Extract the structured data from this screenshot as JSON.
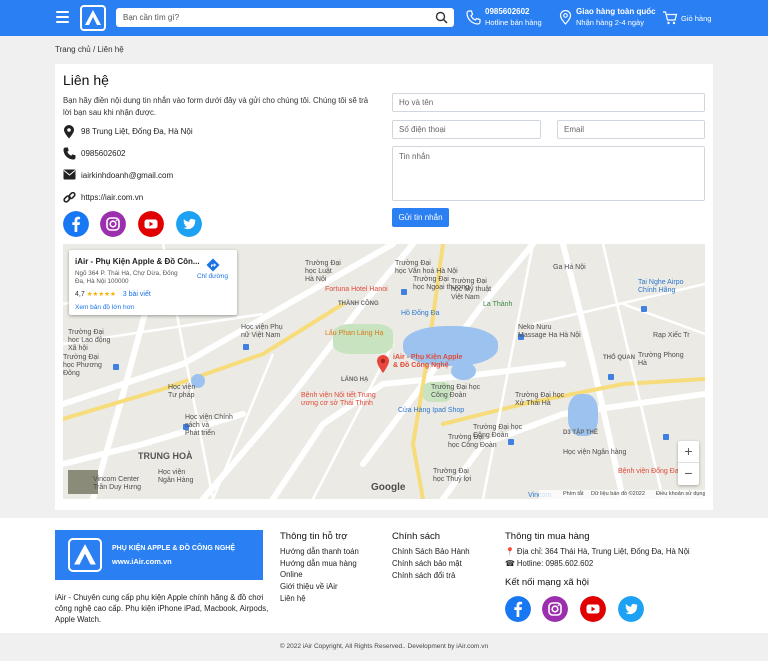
{
  "header": {
    "search_placeholder": "Bạn cần tìm gì?",
    "hotline_number": "0985602602",
    "hotline_label": "Hotline bán hàng",
    "delivery_title": "Giao hàng toàn quốc",
    "delivery_sub": "Nhận hàng 2-4 ngày",
    "cart_label": "Giỏ hàng",
    "accent_color": "#2a7ff3"
  },
  "breadcrumb": "Trang chủ / Liên hệ",
  "contact": {
    "title": "Liên hệ",
    "intro": "Bạn hãy điền nội dung tin nhắn vào form dưới đây và gửi cho chúng tôi. Chúng tôi sẽ trả lời bạn sau khi nhận được.",
    "address": "98 Trung Liệt, Đống Đa, Hà Nội",
    "phone": "0985602602",
    "email": "iairkinhdoanh@gmail.com",
    "website": "https://iair.com.vn"
  },
  "form": {
    "name_placeholder": "Họ và tên",
    "phone_placeholder": "Số điện thoại",
    "email_placeholder": "Email",
    "message_placeholder": "Tin nhắn",
    "submit_label": "Gửi tin nhắn"
  },
  "map": {
    "place_name": "iAir - Phụ Kiện Apple & Đồ Côn...",
    "place_address": "Ngõ 364 P. Thái Hà, Chợ Dừa, Đống Đa, Hà Nội 100000",
    "rating": "4,7",
    "stars": "★★★★★",
    "reviews": "3 bài viết",
    "directions": "Chỉ đường",
    "larger_map": "Xem bản đồ lớn hơn",
    "pin_label_1": "iAir - Phụ Kiện Apple",
    "pin_label_2": "& Đồ Công Nghệ",
    "google": "Google",
    "shortcuts": "Phím tắt",
    "map_data": "Dữ liệu bản đồ ©2022",
    "terms": "Điều khoản sử dụng",
    "zoom_in": "+",
    "zoom_out": "−"
  },
  "footer": {
    "brand_line1": "PHỤ KIỆN APPLE & ĐỒ CÔNG NGHỆ",
    "brand_line2": "www.iAir.com.vn",
    "about": "iAir - Chuyên cung cấp phụ kiện Apple chính hãng & đồ chơi công nghệ cao cấp. Phụ kiện iPhone iPad, Macbook, Airpods, Apple Watch.",
    "support_title": "Thông tin hỗ trợ",
    "support_links": [
      "Hướng dẫn thanh toán",
      "Hướng dẫn mua hàng Online",
      "Giới thiệu về iAir",
      "Liên hệ"
    ],
    "policy_title": "Chính sách",
    "policy_links": [
      "Chính Sách Bảo Hành",
      "Chính sách bảo mật",
      "Chính sách đổi trả"
    ],
    "purchase_title": "Thông tin mua hàng",
    "purchase_address": "📍 Địa chỉ: 364 Thái Hà, Trung Liệt, Đống Đa, Hà Nội",
    "purchase_hotline": "☎ Hotline: 0985.602.602",
    "social_title": "Kết nối mạng xã hội",
    "copyright": "© 2022 iAir Copyright, All Rights Reserved.. Development by iAir.com.vn"
  }
}
